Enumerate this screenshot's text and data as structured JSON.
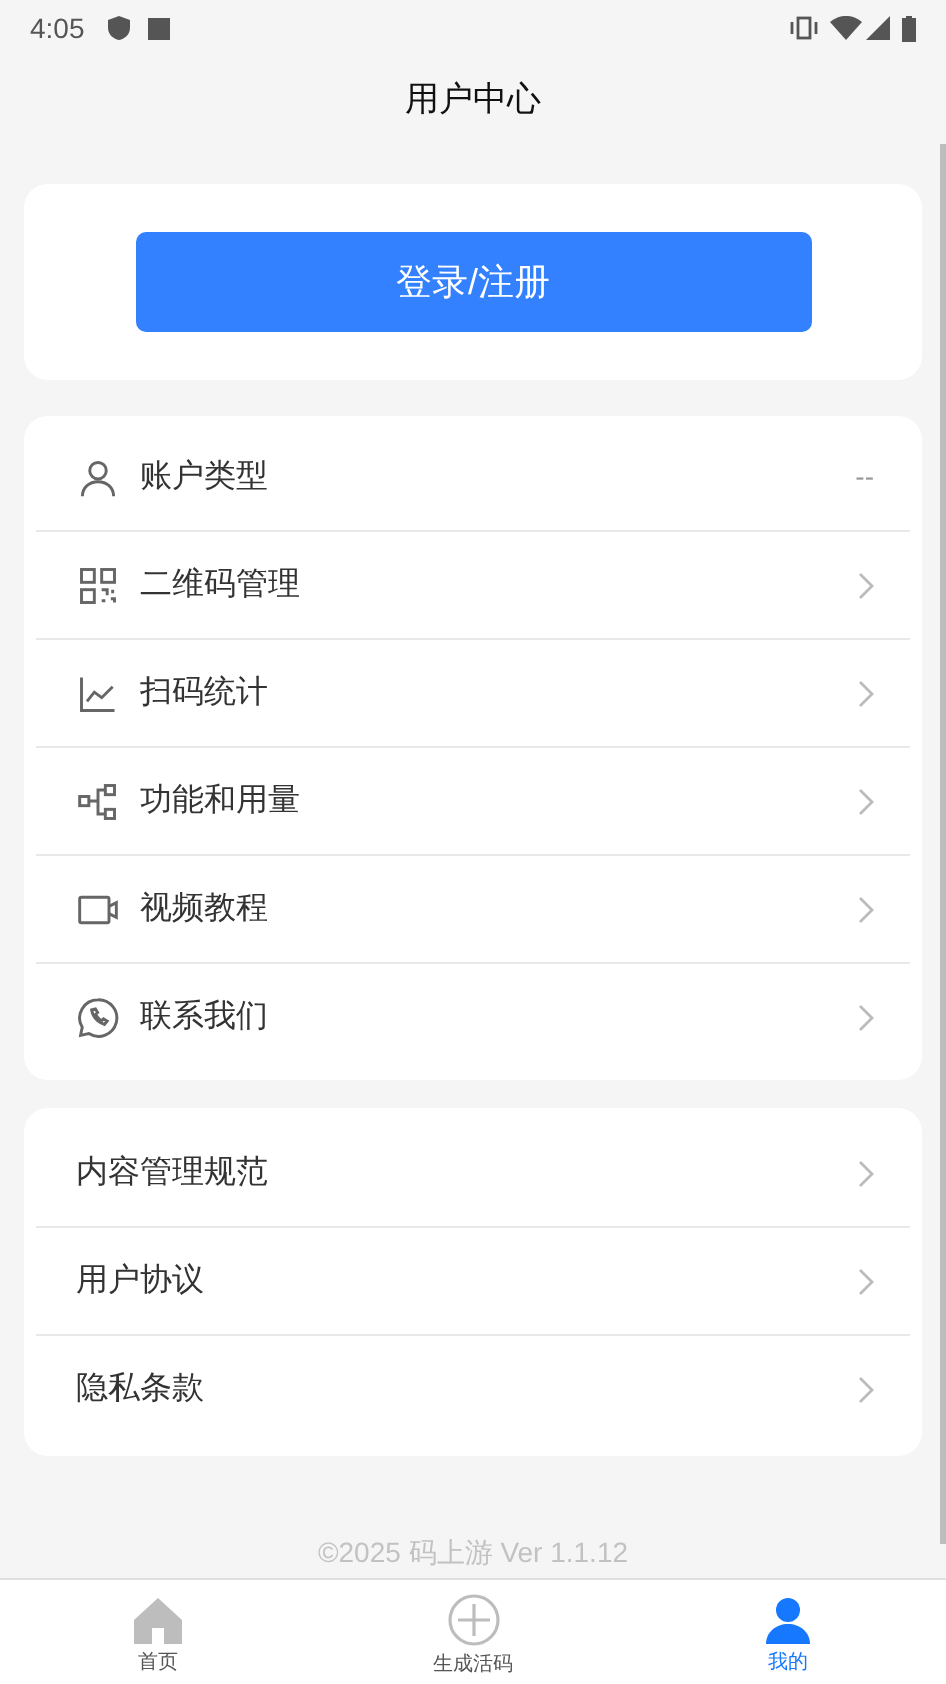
{
  "status_bar": {
    "time": "4:05"
  },
  "header": {
    "title": "用户中心"
  },
  "login_button": {
    "label": "登录/注册"
  },
  "menu": [
    {
      "kind": "user",
      "label": "账户类型",
      "value": "--"
    },
    {
      "kind": "qr",
      "label": "二维码管理"
    },
    {
      "kind": "chart",
      "label": "扫码统计"
    },
    {
      "kind": "nodes",
      "label": "功能和用量"
    },
    {
      "kind": "video",
      "label": "视频教程"
    },
    {
      "kind": "phone",
      "label": "联系我们"
    }
  ],
  "policies": [
    {
      "label": "内容管理规范"
    },
    {
      "label": "用户协议"
    },
    {
      "label": "隐私条款"
    }
  ],
  "footer": "©2025 码上游 Ver 1.1.12",
  "tabs": [
    {
      "kind": "home",
      "label": "首页",
      "selected": false
    },
    {
      "kind": "plus",
      "label": "生成活码",
      "selected": false
    },
    {
      "kind": "person",
      "label": "我的",
      "selected": true
    }
  ]
}
